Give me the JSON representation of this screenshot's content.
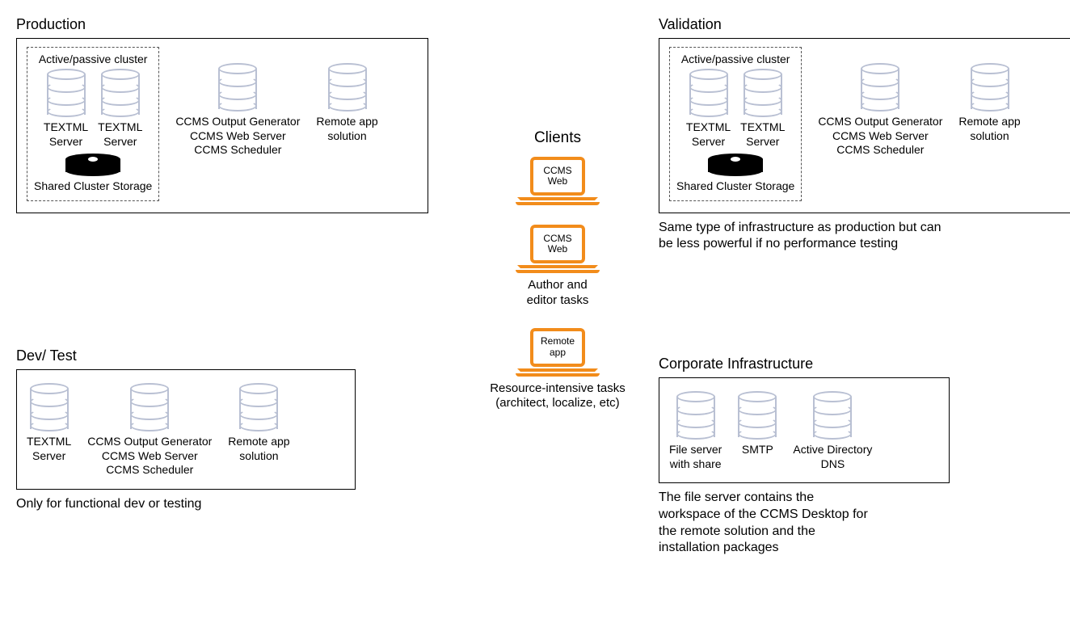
{
  "production": {
    "title": "Production",
    "cluster_title": "Active/passive cluster",
    "textml1": "TEXTML\nServer",
    "textml2": "TEXTML\nServer",
    "shared_storage": "Shared Cluster Storage",
    "ccms_stack": "CCMS Output Generator\nCCMS Web Server\nCCMS Scheduler",
    "remote_app": "Remote app\nsolution"
  },
  "devtest": {
    "title": "Dev/ Test",
    "textml": "TEXTML\nServer",
    "ccms_stack": "CCMS Output Generator\nCCMS Web Server\nCCMS Scheduler",
    "remote_app": "Remote app\nsolution",
    "caption": "Only for functional dev or testing"
  },
  "clients": {
    "title": "Clients",
    "ccms_web_1": "CCMS\nWeb",
    "ccms_web_2": "CCMS\nWeb",
    "ccms_web_2_caption": "Author and\neditor tasks",
    "remote_app": "Remote\napp",
    "remote_app_caption": "Resource-intensive tasks\n(architect, localize, etc)"
  },
  "validation": {
    "title": "Validation",
    "cluster_title": "Active/passive cluster",
    "textml1": "TEXTML\nServer",
    "textml2": "TEXTML\nServer",
    "shared_storage": "Shared Cluster Storage",
    "ccms_stack": "CCMS Output Generator\nCCMS Web Server\nCCMS Scheduler",
    "remote_app": "Remote app\nsolution",
    "caption": "Same type of infrastructure as production but can\nbe less powerful if no performance testing"
  },
  "corporate": {
    "title": "Corporate Infrastructure",
    "file_server": "File server\nwith share",
    "smtp": "SMTP",
    "ad_dns": "Active Directory\nDNS",
    "caption": "The file server contains the\nworkspace of the CCMS Desktop for\nthe remote solution and the\ninstallation packages"
  }
}
